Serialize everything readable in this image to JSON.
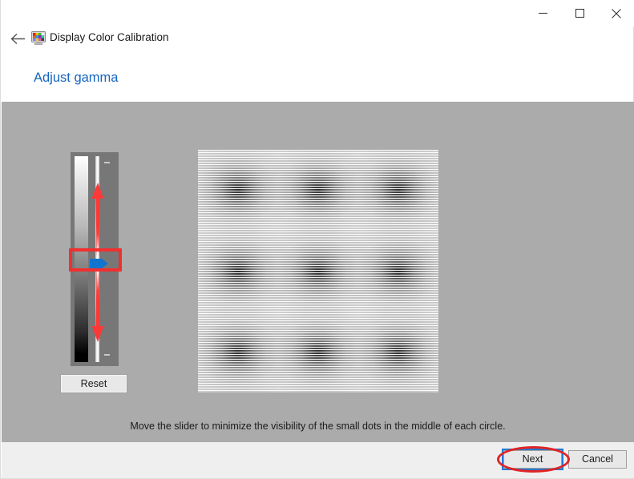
{
  "window": {
    "app_title": "Display Color Calibration",
    "app_icon": "monitor-color-icon",
    "back_icon": "back-arrow-icon",
    "controls": {
      "minimize": "minimize-icon",
      "maximize": "maximize-icon",
      "close": "close-icon"
    }
  },
  "page": {
    "heading": "Adjust gamma",
    "instruction": "Move the slider to minimize the visibility of the small dots in the middle of each circle."
  },
  "slider": {
    "reset_label": "Reset",
    "thumb_icon": "slider-thumb-arrow-icon",
    "up_arrow_icon": "up-arrow-annotation-icon",
    "down_arrow_icon": "down-arrow-annotation-icon",
    "tick_top": "tick-mark",
    "tick_bottom": "tick-mark",
    "thumb_position_percent": 50
  },
  "pattern": {
    "name": "gamma-test-pattern",
    "rows": 3,
    "cols": 3,
    "blob_count": 9
  },
  "footer": {
    "next_label": "Next",
    "cancel_label": "Cancel"
  },
  "annotations": {
    "slider_highlight": "red-rectangle-around-slider-thumb",
    "next_highlight": "red-ellipse-around-next-button"
  },
  "colors": {
    "heading": "#1565c0",
    "content_bg": "#ababab",
    "footer_bg": "#efefef",
    "annotation_red": "#e02424",
    "thumb_blue": "#1175d0",
    "focus_blue": "#1f7ad4",
    "arrow_red": "#fb3a38"
  }
}
